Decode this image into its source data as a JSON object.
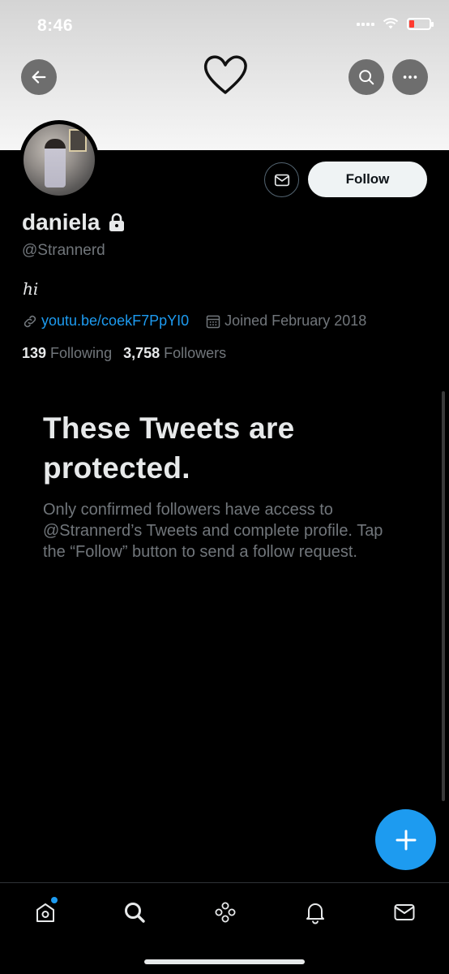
{
  "status_bar": {
    "time": "8:46"
  },
  "profile": {
    "display_name": "daniela",
    "handle": "@Strannerd",
    "bio": "ℎ𝑖",
    "link": "youtu.be/coekF7PpYI0",
    "joined": "Joined February 2018",
    "following_count": "139",
    "following_label": "Following",
    "followers_count": "3,758",
    "followers_label": "Followers"
  },
  "actions": {
    "follow_label": "Follow"
  },
  "protected_notice": {
    "title": "These Tweets are protected.",
    "body": "Only confirmed followers have access to @Strannerd’s Tweets and complete profile. Tap the “Follow” button to send a follow request."
  },
  "icons": {
    "back": "back-arrow-icon",
    "search": "search-icon",
    "more": "more-icon",
    "lock": "lock-icon",
    "link": "link-icon",
    "calendar": "calendar-icon",
    "compose": "plus-icon",
    "message": "envelope-icon",
    "tabs": [
      "home-icon",
      "search-icon",
      "spaces-icon",
      "bell-icon",
      "envelope-icon"
    ]
  },
  "colors": {
    "accent": "#1d9bf0",
    "background": "#000000",
    "text_primary": "#e7e9ea",
    "text_secondary": "#71767b"
  }
}
